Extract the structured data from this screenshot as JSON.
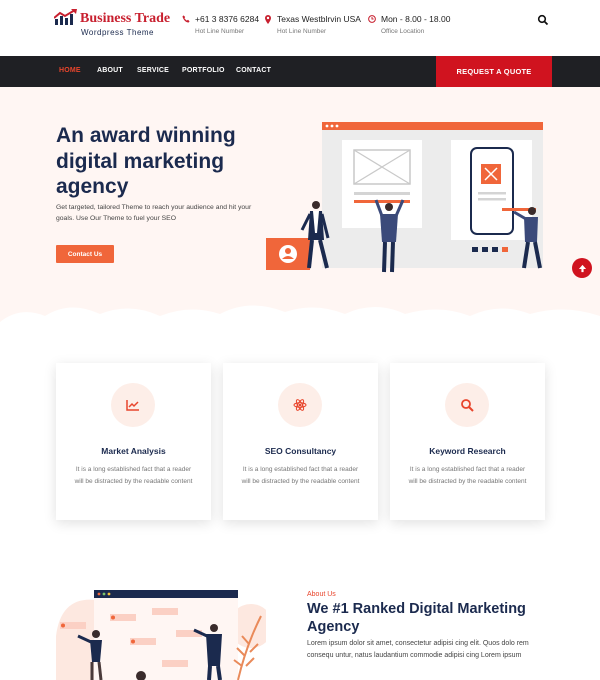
{
  "brand": {
    "title": "Business Trade",
    "subtitle": "Wordpress Theme",
    "colors": {
      "primary": "#d0131f",
      "accent": "#f0663a",
      "navy": "#1b2a4e",
      "nav_bg": "#1f2024"
    }
  },
  "contact_info": [
    {
      "icon": "phone-icon",
      "value": "+61 3 8376 6284",
      "label": "Hot Line Number"
    },
    {
      "icon": "location-pin-icon",
      "value": "Texas Westblrvin USA",
      "label": "Hot Line Number"
    },
    {
      "icon": "clock-icon",
      "value": "Mon - 8.00 - 18.00",
      "label": "Office Location"
    }
  ],
  "nav": {
    "items": [
      "HOME",
      "ABOUT",
      "SERVICE",
      "PORTFOLIO",
      "CONTACT"
    ],
    "active": "HOME",
    "cta": "REQUEST A QUOTE"
  },
  "hero": {
    "title": "An award winning digital marketing agency",
    "description": "Get targeted, tailored Theme to reach your audience and hit your goals. Use Our Theme to fuel your SEO",
    "button": "Contact Us"
  },
  "services": [
    {
      "icon": "chart-line-icon",
      "title": "Market Analysis",
      "text": "It is a long established fact that a reader will be distracted by the readable content"
    },
    {
      "icon": "atom-icon",
      "title": "SEO Consultancy",
      "text": "It is a long established fact that a reader will be distracted by the readable content"
    },
    {
      "icon": "search-icon",
      "title": "Keyword Research",
      "text": "It is a long established fact that a reader will be distracted by the readable content"
    }
  ],
  "about": {
    "label": "About Us",
    "title": "We #1 Ranked Digital Marketing Agency",
    "text": "Lorem ipsum dolor sit amet, consectetur adipisi cing elit. Quos dolo rem consequ untur, natus laudantium commodie adipisi cing Lorem ipsum"
  }
}
